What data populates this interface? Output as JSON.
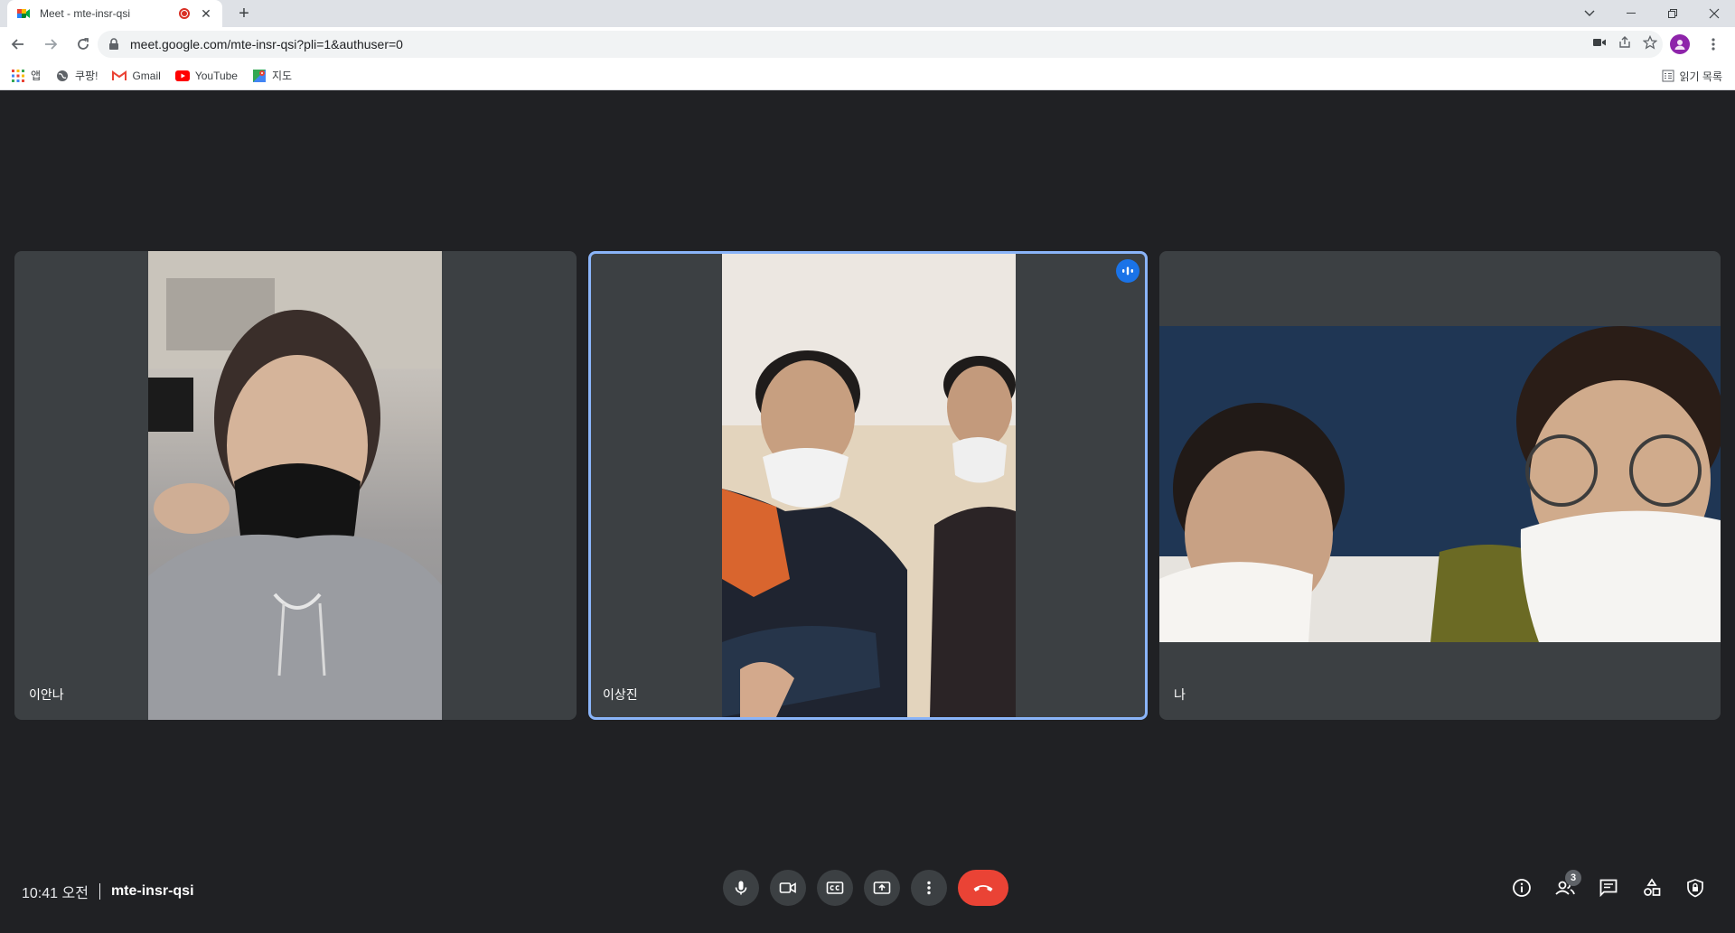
{
  "browser": {
    "tab_title": "Meet - mte-insr-qsi",
    "new_tab_label": "+",
    "url": "meet.google.com/mte-insr-qsi?pli=1&authuser=0"
  },
  "bookmarks": {
    "items": [
      {
        "label": "앱",
        "icon": "apps-grid-icon"
      },
      {
        "label": "쿠팡!",
        "icon": "globe-icon"
      },
      {
        "label": "Gmail",
        "icon": "gmail-icon"
      },
      {
        "label": "YouTube",
        "icon": "youtube-icon"
      },
      {
        "label": "지도",
        "icon": "maps-icon"
      }
    ],
    "reading_list": "읽기 목록"
  },
  "participants": [
    {
      "name": "이안나",
      "speaking": false
    },
    {
      "name": "이상진",
      "speaking": true
    },
    {
      "name": "나",
      "speaking": false
    }
  ],
  "meeting": {
    "time": "10:41 오전",
    "code": "mte-insr-qsi"
  },
  "people_count": "3",
  "colors": {
    "background": "#202124",
    "tile": "#3c4043",
    "active_border": "#8ab4f8",
    "end_call": "#ea4335",
    "speaking_badge": "#1a73e8"
  }
}
